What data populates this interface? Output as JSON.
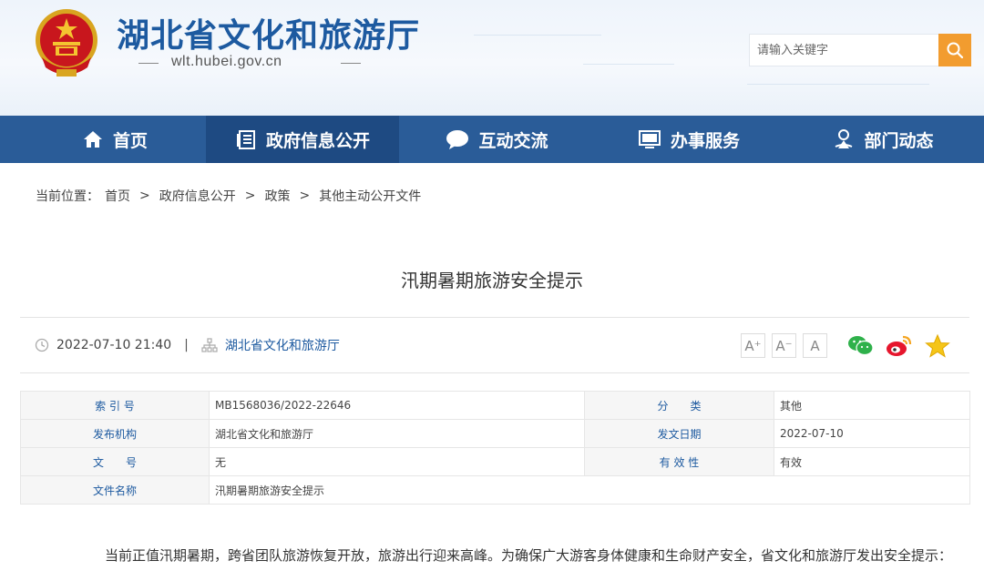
{
  "header": {
    "site_title": "湖北省文化和旅游厅",
    "site_domain": "wlt.hubei.gov.cn",
    "search_placeholder": "请输入关键字"
  },
  "nav": {
    "items": [
      {
        "label": "首页",
        "icon": "home-icon"
      },
      {
        "label": "政府信息公开",
        "icon": "document-list-icon",
        "active": true
      },
      {
        "label": "互动交流",
        "icon": "chat-bubble-icon"
      },
      {
        "label": "办事服务",
        "icon": "monitor-icon"
      },
      {
        "label": "部门动态",
        "icon": "person-pin-icon"
      }
    ]
  },
  "breadcrumb": {
    "prefix": "当前位置：",
    "items": [
      "首页",
      "政府信息公开",
      "政策",
      "其他主动公开文件"
    ],
    "separator": ">"
  },
  "article": {
    "title": "汛期暑期旅游安全提示",
    "datetime": "2022-07-10 21:40",
    "pipe": "|",
    "source": "湖北省文化和旅游厅",
    "font_buttons": [
      "A⁺",
      "A⁻",
      "A"
    ],
    "body_first_line": "当前正值汛期暑期，跨省团队旅游恢复开放，旅游出行迎来高峰。为确保广大游客身体健康和生命财产安全，省文化和旅游厅发出安全提示："
  },
  "info_table": {
    "rows": [
      {
        "label1": "索 引 号",
        "value1": "MB1568036/2022-22646",
        "label2": "分　　类",
        "value2": "其他"
      },
      {
        "label1": "发布机构",
        "value1": "湖北省文化和旅游厅",
        "label2": "发文日期",
        "value2": "2022-07-10"
      },
      {
        "label1": "文　　号",
        "value1": "无",
        "label2": "有 效 性",
        "value2": "有效"
      },
      {
        "label1": "文件名称",
        "value1": "汛期暑期旅游安全提示"
      }
    ]
  },
  "colors": {
    "nav_bg": "#2a5c98",
    "nav_active": "#1e4a82",
    "title_blue": "#1d5aa0",
    "search_btn": "#f29c2f"
  }
}
